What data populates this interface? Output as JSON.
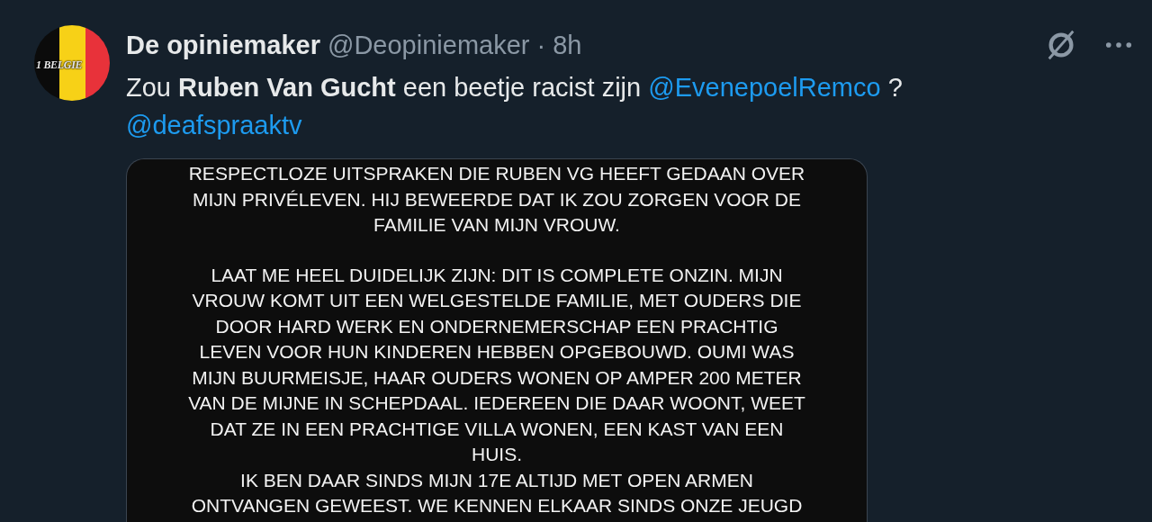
{
  "tweet": {
    "avatar_text": "1 BELGIE",
    "name": "De opiniemaker",
    "handle": "@Deopiniemaker",
    "separator": "·",
    "time": "8h",
    "text": [
      {
        "kind": "text",
        "text": "Zou **Ruben Van Gucht** een beetje racist zijn"
      },
      {
        "kind": "mention",
        "text": "@EvenepoelRemco"
      },
      {
        "kind": "text",
        "text": "?"
      },
      {
        "kind": "mention",
        "text": "@deafspraaktv"
      }
    ],
    "image": {
      "paragraphs": [
        [
          "RESPECTLOZE UITSPRAKEN DIE RUBEN VG HEEFT GEDAAN OVER",
          "MIJN PRIVÉLEVEN. HIJ BEWEERDE DAT IK ZOU ZORGEN VOOR DE",
          "FAMILIE VAN MIJN VROUW."
        ],
        [
          "LAAT ME HEEL DUIDELIJK ZIJN: DIT IS COMPLETE ONZIN. MIJN",
          "VROUW KOMT UIT EEN WELGESTELDE FAMILIE, MET OUDERS DIE",
          "DOOR HARD WERK EN ONDERNEMERSCHAP EEN PRACHTIG",
          "LEVEN VOOR HUN KINDEREN HEBBEN OPGEBOUWD. OUMI WAS",
          "MIJN BUURMEISJE, HAAR OUDERS WONEN OP AMPER 200 METER",
          "VAN DE MIJNE IN SCHEPDAAL. IEDEREEN DIE DAAR WOONT, WEET",
          "DAT ZE IN EEN PRACHTIGE VILLA WONEN, EEN KAST VAN EEN",
          "HUIS.",
          "IK BEN DAAR SINDS MIJN 17E ALTIJD MET OPEN ARMEN",
          "ONTVANGEN GEWEEST. WE KENNEN ELKAAR SINDS ONZE JEUGD"
        ]
      ]
    }
  }
}
